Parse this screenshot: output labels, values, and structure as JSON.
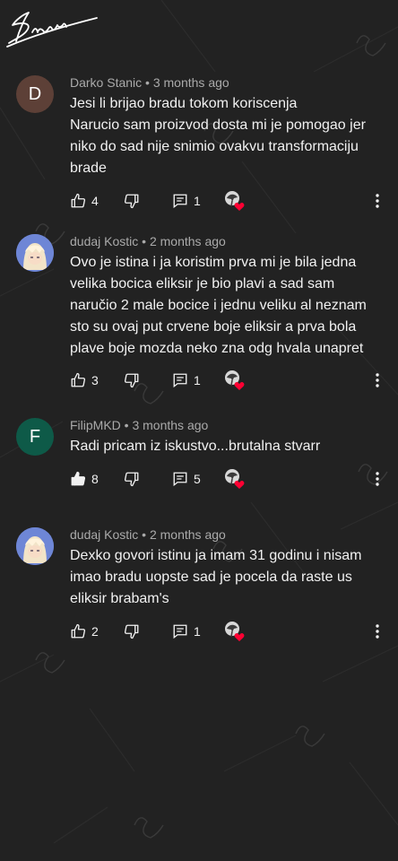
{
  "logo": {
    "text": "Barbam's"
  },
  "comments": [
    {
      "author": "Darko Stanic",
      "age": "3 months ago",
      "avatar_letter": "D",
      "text": "Jesi li brijao bradu tokom koriscenja\nNarucio sam proizvod dosta mi je pomogao jer niko do sad nije snimio ovakvu transformaciju brade",
      "likes": "4",
      "replies": "1"
    },
    {
      "author": "dudaj Kostic",
      "age": "2 months ago",
      "avatar_letter": "",
      "text": "Ovo je istina i ja koristim prva mi je bila jedna velika bocica eliksir je bio plavi a sad sam naručio 2 male bocice i jednu veliku al neznam sto su ovaj put crvene boje eliksir a prva bola plave boje mozda neko zna odg hvala unapret",
      "likes": "3",
      "replies": "1"
    },
    {
      "author": "FilipMKD",
      "age": "3 months ago",
      "avatar_letter": "F",
      "text": "Radi pricam iz iskustvo...brutalna stvarr",
      "likes": "8",
      "replies": "5"
    },
    {
      "author": "dudaj Kostic",
      "age": "2 months ago",
      "avatar_letter": "",
      "text": "Dexko govori istinu ja imam 31 godinu i nisam imao bradu uopste sad je pocela da raste us eliksir brabam's",
      "likes": "2",
      "replies": "1"
    }
  ],
  "colors": {
    "background": "#222222",
    "text": "#f1f1f1",
    "meta": "#aaaaaa",
    "heart": "#ff0033",
    "avatar_d": "#5d4037",
    "avatar_f": "#0e5a48"
  },
  "icons": {
    "like": "thumb-up-icon",
    "dislike": "thumb-down-icon",
    "replies": "comment-icon",
    "creator_heart": "creator-heart-icon",
    "more": "more-vert-icon"
  }
}
